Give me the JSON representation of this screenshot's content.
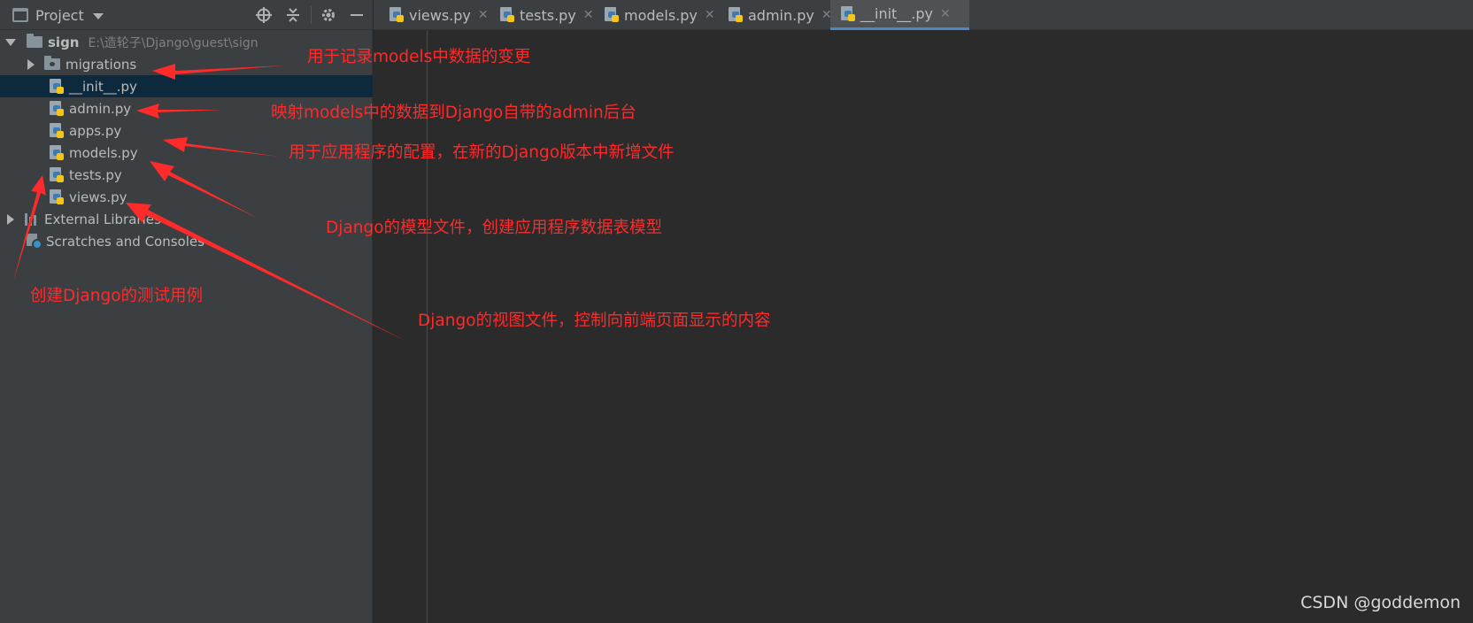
{
  "project_panel": {
    "title": "Project",
    "tree": {
      "root": {
        "label": "sign",
        "path": "E:\\造轮子\\Django\\guest\\sign"
      },
      "migrations": "migrations",
      "files": [
        "__init__.py",
        "admin.py",
        "apps.py",
        "models.py",
        "tests.py",
        "views.py"
      ],
      "external_libraries": "External Libraries",
      "scratches": "Scratches and Consoles"
    }
  },
  "tabs": [
    {
      "label": "views.py"
    },
    {
      "label": "tests.py"
    },
    {
      "label": "models.py"
    },
    {
      "label": "admin.py"
    },
    {
      "label": "__init__.py",
      "active": true
    }
  ],
  "annotations": {
    "migrations": "用于记录models中数据的变更",
    "admin": "映射models中的数据到Django自带的admin后台",
    "apps": "用于应用程序的配置，在新的Django版本中新增文件",
    "models": "Django的模型文件，创建应用程序数据表模型",
    "tests": "创建Django的测试用例",
    "views": "Django的视图文件，控制向前端页面显示的内容"
  },
  "watermark": "CSDN @goddemon",
  "colors": {
    "annotation": "#ff2a2a",
    "panel_bg": "#3c3f41",
    "editor_bg": "#2b2b2b",
    "selected_row": "#0d293e",
    "active_tab_underline": "#4a88c7"
  }
}
